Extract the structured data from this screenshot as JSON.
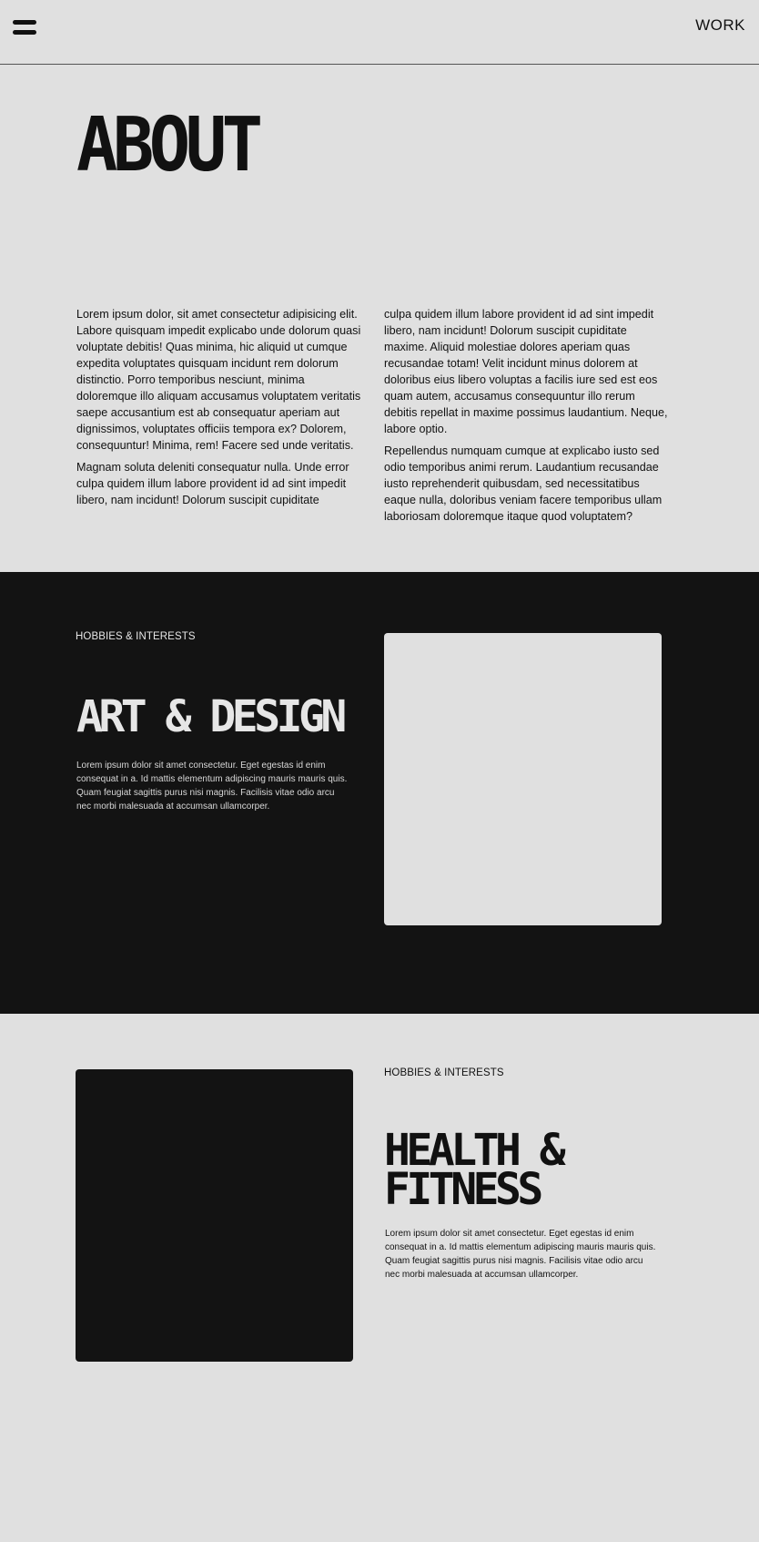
{
  "header": {
    "menu_icon": "hamburger-menu-icon",
    "work_link": "WORK"
  },
  "about": {
    "title": "ABOUT",
    "left_column": [
      "Lorem ipsum dolor, sit amet consectetur adipisicing elit. Labore quisquam impedit explicabo unde dolorum quasi voluptate debitis! Quas minima, hic aliquid ut cumque expedita voluptates quisquam incidunt rem dolorum distinctio. Porro temporibus nesciunt, minima doloremque illo aliquam accusamus voluptatem veritatis saepe accusantium est ab consequatur aperiam aut dignissimos, voluptates officiis tempora ex? Dolorem, consequuntur! Minima, rem! Facere sed unde veritatis.",
      "Magnam soluta deleniti consequatur nulla. Unde error culpa quidem illum labore provident id ad sint impedit libero, nam incidunt! Dolorum suscipit cupiditate"
    ],
    "right_column": [
      "culpa quidem illum labore provident id ad sint impedit libero, nam incidunt! Dolorum suscipit cupiditate maxime. Aliquid molestiae dolores aperiam quas recusandae totam! Velit incidunt minus dolorem at doloribus eius libero voluptas a facilis iure sed est eos quam autem, accusamus consequuntur illo rerum debitis repellat in maxime possimus laudantium. Neque, labore optio.",
      "Repellendus numquam cumque at explicabo iusto sed odio temporibus animi rerum. Laudantium recusandae iusto reprehenderit quibusdam, sed necessitatibus eaque nulla, doloribus veniam facere temporibus ullam laboriosam doloremque itaque quod voluptatem? Magnam nulla porro sint fugit ullam cum officiis natus, ad"
    ]
  },
  "hobby_art": {
    "eyebrow": "HOBBIES & INTERESTS",
    "title": "ART & DESIGN",
    "body": "Lorem ipsum dolor sit amet consectetur. Eget egestas id enim consequat in a. Id mattis elementum adipiscing mauris mauris quis. Quam feugiat sagittis purus nisi magnis. Facilisis vitae odio arcu nec morbi malesuada at accumsan ullamcorper."
  },
  "hobby_health": {
    "eyebrow": "HOBBIES & INTERESTS",
    "title": "HEALTH & FITNESS",
    "body": "Lorem ipsum dolor sit amet consectetur. Eget egestas id enim consequat in a. Id mattis elementum adipiscing mauris mauris quis. Quam feugiat sagittis purus nisi magnis. Facilisis vitae odio arcu nec morbi malesuada at accumsan ullamcorper."
  },
  "colors": {
    "background_light": "#e0e0e0",
    "background_dark": "#131313",
    "text_dark": "#111111",
    "text_light": "#e6e6e6"
  }
}
